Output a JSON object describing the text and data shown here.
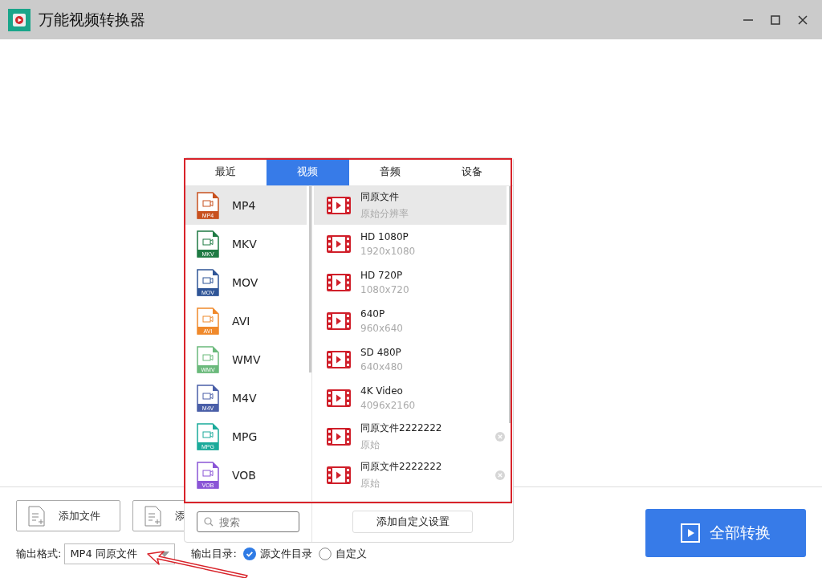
{
  "window": {
    "title": "万能视频转换器"
  },
  "toolbar": {
    "buttons": [
      {
        "label": "添加文件"
      },
      {
        "label": "添"
      }
    ]
  },
  "output_format": {
    "label": "输出格式:",
    "value": "MP4 同原文件"
  },
  "output_dir": {
    "label": "输出目录:",
    "options": [
      {
        "label": "源文件目录",
        "selected": true
      },
      {
        "label": "自定义",
        "selected": false
      }
    ]
  },
  "convert_button": {
    "label": "全部转换"
  },
  "format_popup": {
    "tabs": [
      {
        "label": "最近",
        "selected": false
      },
      {
        "label": "视频",
        "selected": true
      },
      {
        "label": "音频",
        "selected": false
      },
      {
        "label": "设备",
        "selected": false
      }
    ],
    "formats": [
      {
        "name": "MP4",
        "badge": "MP4",
        "color": "#c8511f",
        "selected": true
      },
      {
        "name": "MKV",
        "badge": "MKV",
        "color": "#1e7a43",
        "selected": false
      },
      {
        "name": "MOV",
        "badge": "MOV",
        "color": "#2f5597",
        "selected": false
      },
      {
        "name": "AVI",
        "badge": "AVI",
        "color": "#f0892b",
        "selected": false
      },
      {
        "name": "WMV",
        "badge": "WMV",
        "color": "#6ab97b",
        "selected": false
      },
      {
        "name": "M4V",
        "badge": "M4V",
        "color": "#4a5fa8",
        "selected": false
      },
      {
        "name": "MPG",
        "badge": "MPG",
        "color": "#1aaa9a",
        "selected": false
      },
      {
        "name": "VOB",
        "badge": "VOB",
        "color": "#8a55d6",
        "selected": false
      }
    ],
    "presets": [
      {
        "title": "同原文件",
        "detail": "原始分辨率",
        "selected": true,
        "removable": false
      },
      {
        "title": "HD 1080P",
        "detail": "1920x1080",
        "selected": false,
        "removable": false
      },
      {
        "title": "HD 720P",
        "detail": "1080x720",
        "selected": false,
        "removable": false
      },
      {
        "title": "640P",
        "detail": "960x640",
        "selected": false,
        "removable": false
      },
      {
        "title": "SD 480P",
        "detail": "640x480",
        "selected": false,
        "removable": false
      },
      {
        "title": "4K Video",
        "detail": "4096x2160",
        "selected": false,
        "removable": false
      },
      {
        "title": "同原文件2222222",
        "detail": "原始",
        "selected": false,
        "removable": true
      },
      {
        "title": "同原文件2222222",
        "detail": "原始",
        "selected": false,
        "removable": true
      }
    ],
    "search": {
      "placeholder": "搜索"
    },
    "custom_button": {
      "label": "添加自定义设置"
    }
  }
}
